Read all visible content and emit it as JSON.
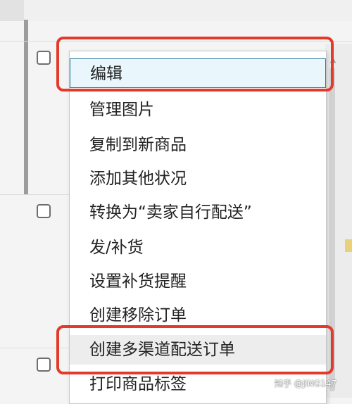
{
  "menu": {
    "items": [
      {
        "label": "编辑",
        "state": "active"
      },
      {
        "label": "管理图片"
      },
      {
        "label": "复制到新商品"
      },
      {
        "label": "添加其他状况"
      },
      {
        "label": "转换为“卖家自行配送”"
      },
      {
        "label": "发/补货"
      },
      {
        "label": "设置补货提醒"
      },
      {
        "label": "创建移除订单"
      },
      {
        "label": "创建多渠道配送订单",
        "state": "hover"
      },
      {
        "label": "打印商品标签"
      }
    ]
  },
  "annotations": {
    "highlight_color": "#e33a2c"
  },
  "watermark": {
    "text": "知乎 @JING147"
  }
}
